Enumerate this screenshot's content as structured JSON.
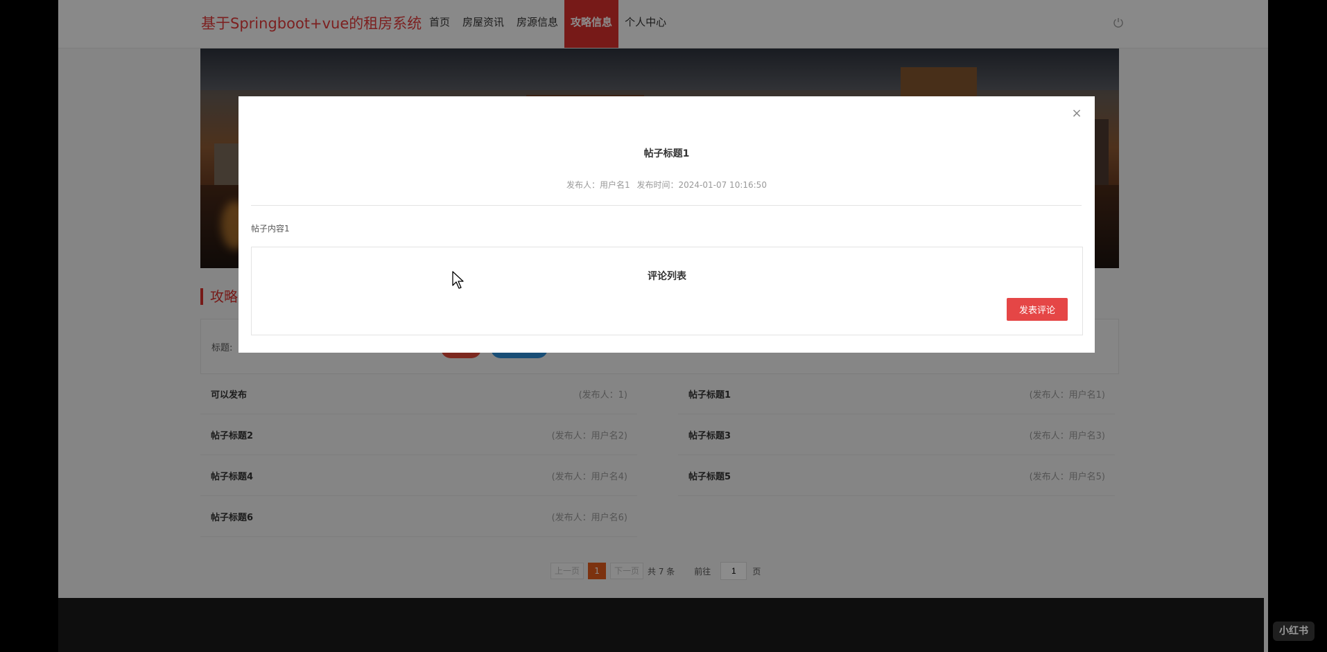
{
  "header": {
    "brand": "基于Springboot+vue的租房系统",
    "nav": [
      "首页",
      "房屋资讯",
      "房源信息",
      "攻略信息",
      "个人中心"
    ],
    "active_nav": "攻略信息"
  },
  "section": {
    "title": "攻略信息"
  },
  "search": {
    "label": "标题:"
  },
  "posts": [
    {
      "title": "可以发布",
      "author": "(发布人：1)"
    },
    {
      "title": "帖子标题1",
      "author": "(发布人：用户名1)"
    },
    {
      "title": "帖子标题2",
      "author": "(发布人：用户名2)"
    },
    {
      "title": "帖子标题3",
      "author": "(发布人：用户名3)"
    },
    {
      "title": "帖子标题4",
      "author": "(发布人：用户名4)"
    },
    {
      "title": "帖子标题5",
      "author": "(发布人：用户名5)"
    },
    {
      "title": "帖子标题6",
      "author": "(发布人：用户名6)"
    }
  ],
  "pagination": {
    "prev": "上一页",
    "current": "1",
    "next": "下一页",
    "total": "共 7 条",
    "goto": "前往",
    "page_value": "1",
    "page_unit": "页"
  },
  "modal": {
    "close": "×",
    "title": "帖子标题1",
    "author_label": "发布人：用户名1",
    "time_label": "发布时间：2024-01-07 10:16:50",
    "content": "帖子内容1",
    "comment_list_title": "评论列表",
    "comment_button": "发表评论"
  },
  "watermark": "小红书",
  "colors": {
    "accent": "#d9302d",
    "button": "#e54646",
    "pager_active": "#e25c1d"
  }
}
